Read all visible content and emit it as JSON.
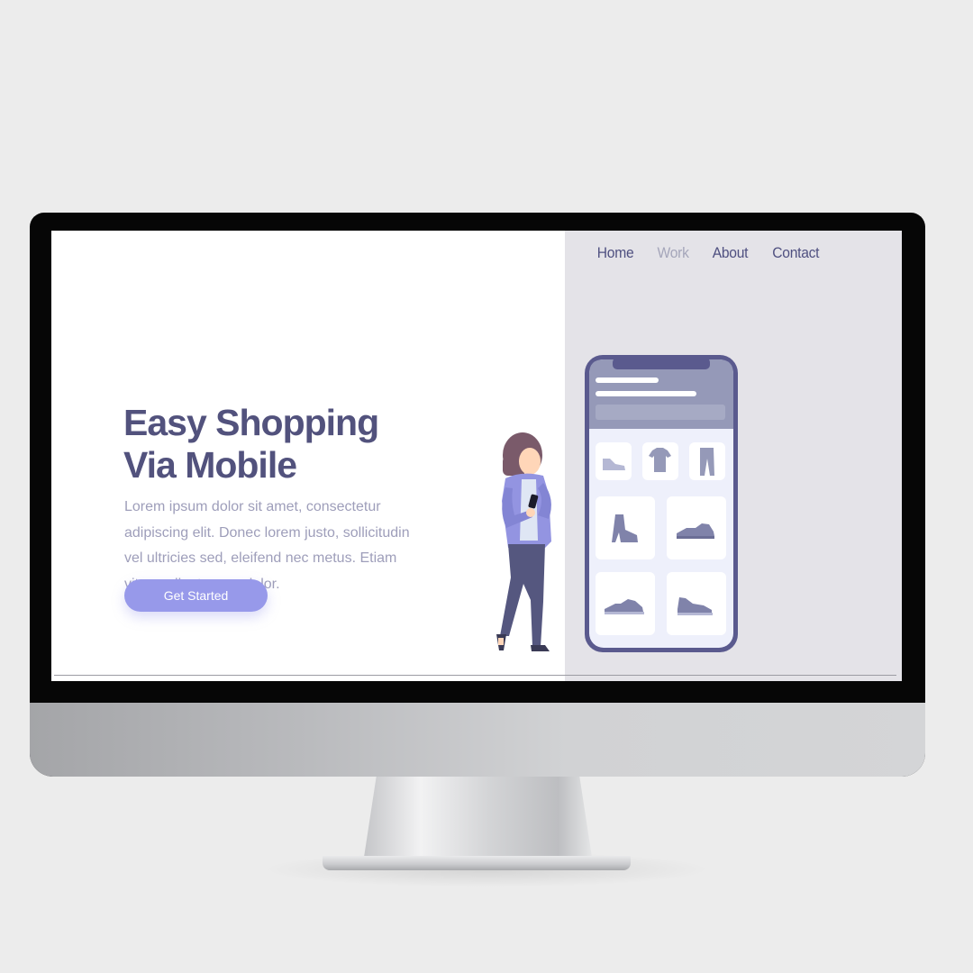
{
  "nav": {
    "items": [
      {
        "label": "Home",
        "active": false
      },
      {
        "label": "Work",
        "active": true
      },
      {
        "label": "About",
        "active": false
      },
      {
        "label": "Contact",
        "active": false
      }
    ]
  },
  "hero": {
    "title_line1": "Easy Shopping",
    "title_line2": "Via Mobile",
    "body": "Lorem ipsum dolor sit amet, consectetur adipiscing elit. Donec lorem justo, sollicitudin vel ultricies sed, eleifend nec metus. Etiam vitae pellentesque dolor.",
    "cta_label": "Get Started"
  },
  "illustration": {
    "products": [
      "shoe-icon",
      "tshirt-icon",
      "pants-icon",
      "boot-icon",
      "sneaker-icon",
      "sneaker-icon",
      "sneaker-icon"
    ]
  },
  "colors": {
    "accent": "#9799ea",
    "heading": "#52527d",
    "body_text": "#9e9eba",
    "panel_bg": "#e4e3e8",
    "phone_frame": "#5a5a8e",
    "phone_header": "#9599b8"
  }
}
